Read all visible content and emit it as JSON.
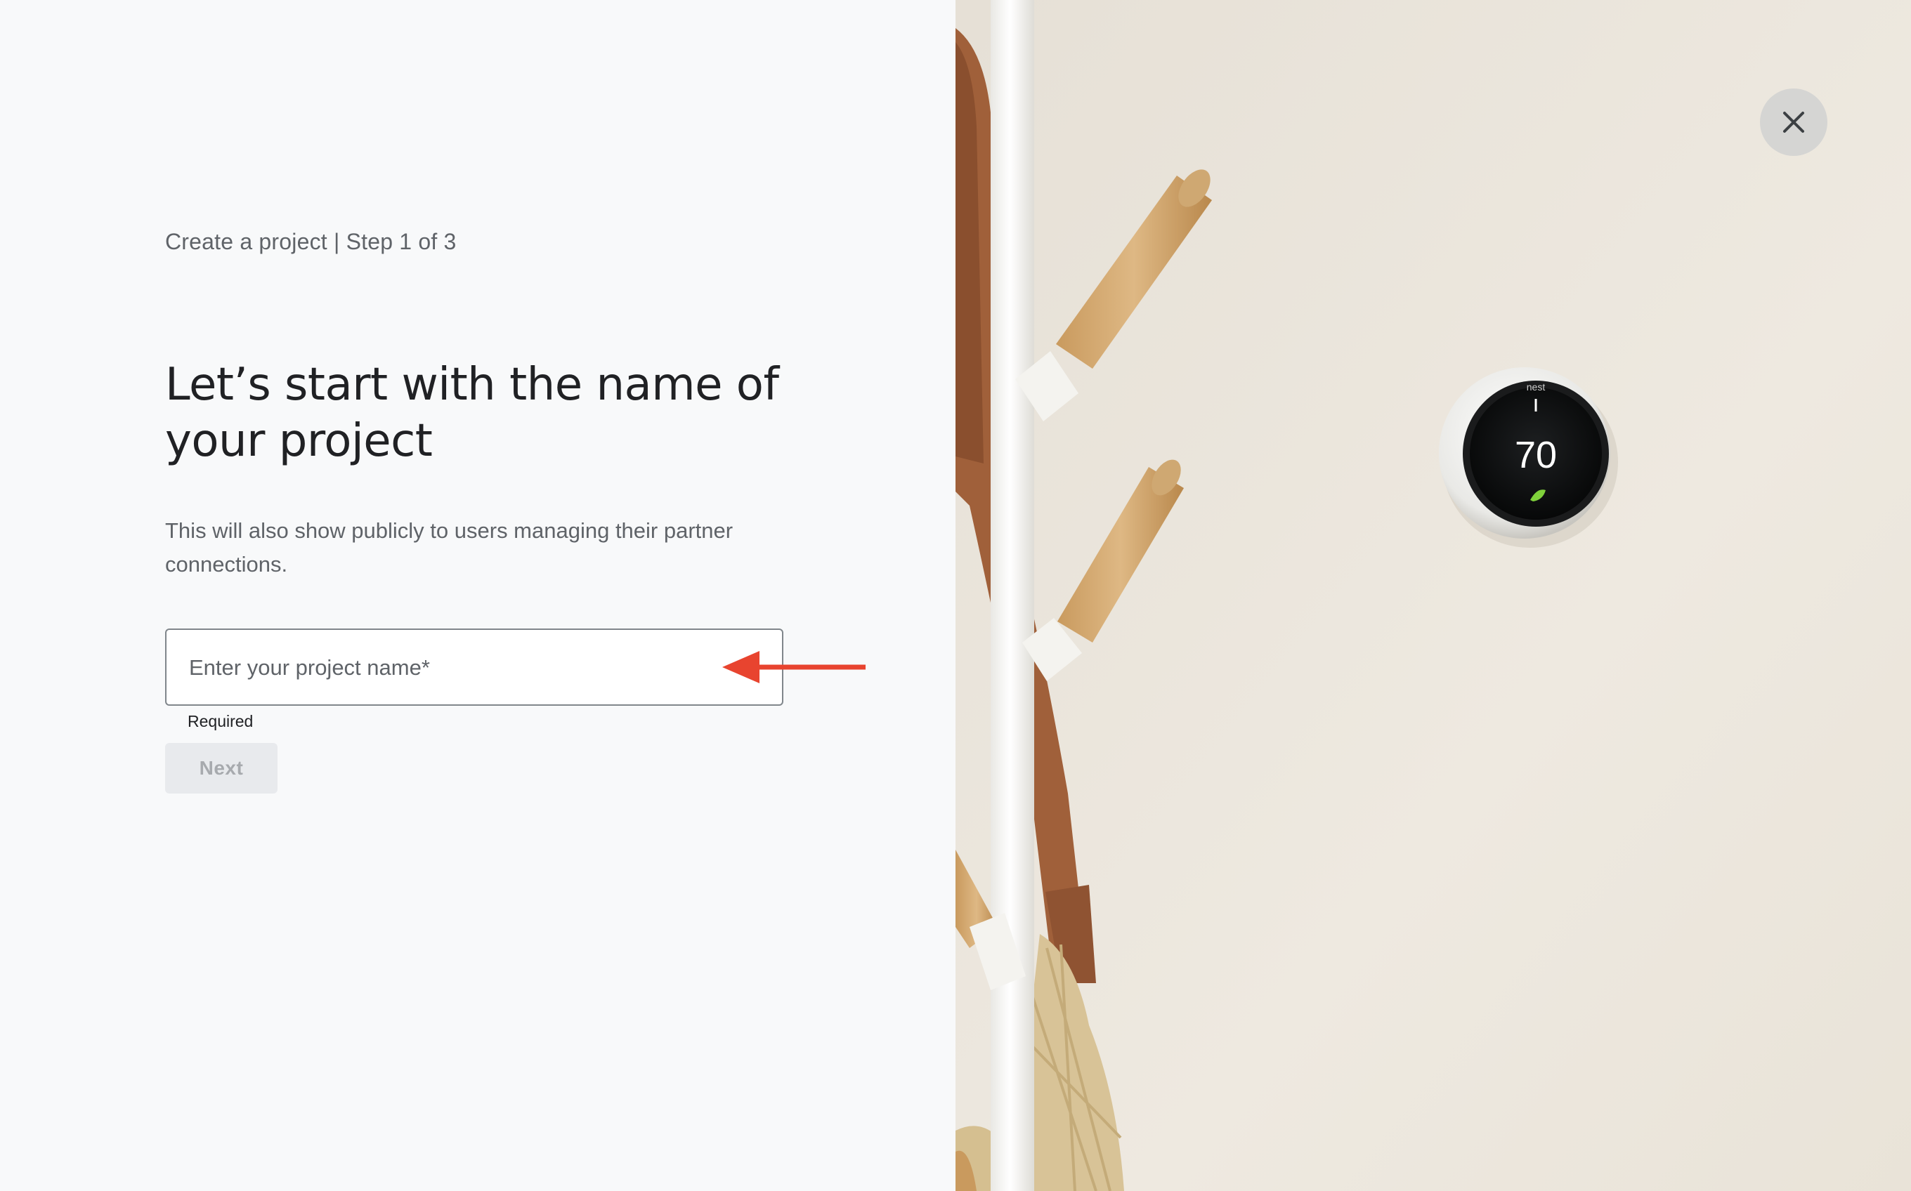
{
  "form": {
    "step_label": "Create a project | Step 1 of 3",
    "heading": "Let’s start with the name of your project",
    "description": "This will also show publicly to users managing their partner connections.",
    "name_input": {
      "placeholder": "Enter your project name*",
      "value": ""
    },
    "helper_text": "Required",
    "next_button_label": "Next"
  },
  "hero": {
    "thermostat_brand": "nest",
    "thermostat_temperature": "70"
  },
  "colors": {
    "annotation_arrow": "#e8442f",
    "background": "#f8f9fa",
    "wall": "#ece7dd"
  },
  "icons": {
    "close": "close-icon",
    "arrow": "arrow-left-icon",
    "leaf": "leaf-icon"
  }
}
